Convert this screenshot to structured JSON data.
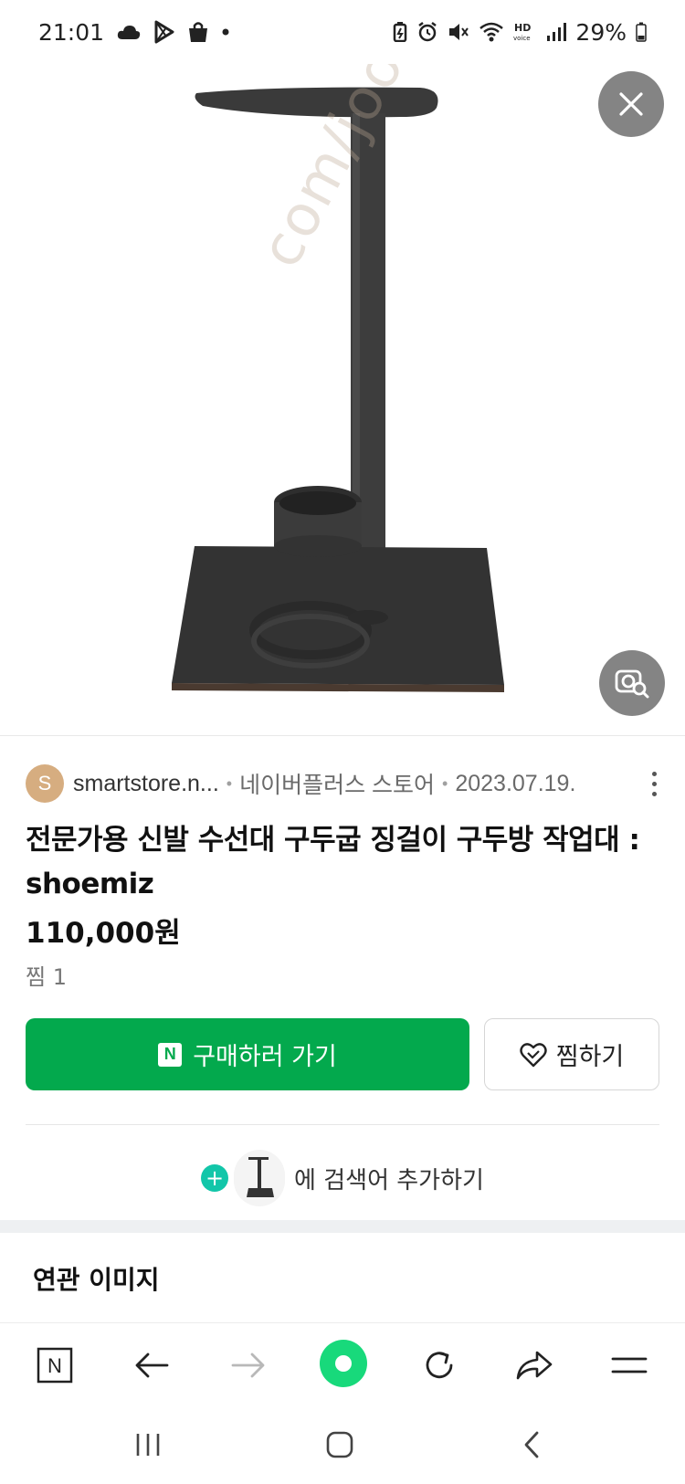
{
  "status_bar": {
    "time": "21:01",
    "battery": "29%"
  },
  "image": {
    "watermark": "com/joong"
  },
  "result": {
    "avatar_letter": "S",
    "source": "smartstore.n...",
    "store": "네이버플러스 스토어",
    "date": "2023.07.19.",
    "title": "전문가용 신발 수선대 구두굽 징걸이 구두방 작업대 : shoemiz",
    "price": "110,000원",
    "likes": "찜 1"
  },
  "actions": {
    "buy_badge": "N",
    "buy_label": "구매하러 가기",
    "wish_label": "찜하기"
  },
  "search_add": {
    "label": "에 검색어 추가하기"
  },
  "related": {
    "heading": "연관 이미지"
  },
  "toolbar": {
    "home_badge": "N"
  },
  "colors": {
    "buy_button": "#03a94d",
    "green_dot": "#18d97b",
    "plus_accent": "#12c6a9"
  }
}
